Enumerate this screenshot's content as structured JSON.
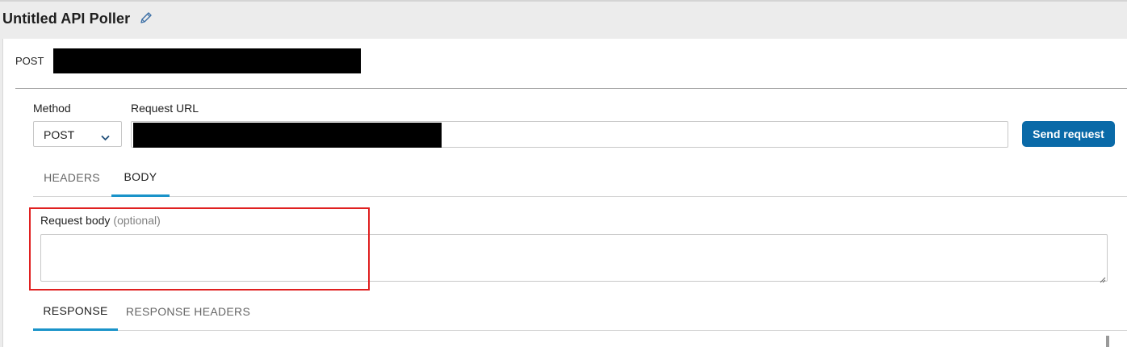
{
  "window": {
    "title": "Untitled API Poller",
    "edit_icon": "pencil-icon"
  },
  "summary": {
    "method": "POST"
  },
  "request": {
    "method_label": "Method",
    "method_value": "POST",
    "url_label": "Request URL",
    "send_label": "Send request"
  },
  "request_tabs": [
    {
      "label": "HEADERS",
      "active": false
    },
    {
      "label": "BODY",
      "active": true
    }
  ],
  "body": {
    "label": "Request body",
    "optional": "(optional)",
    "value": ""
  },
  "response_tabs": [
    {
      "label": "RESPONSE",
      "active": true
    },
    {
      "label": "RESPONSE HEADERS",
      "active": false
    }
  ],
  "colors": {
    "accent_button": "#0a6aa8",
    "active_tab_underline": "#1a93c9",
    "highlight": "#e02020"
  }
}
